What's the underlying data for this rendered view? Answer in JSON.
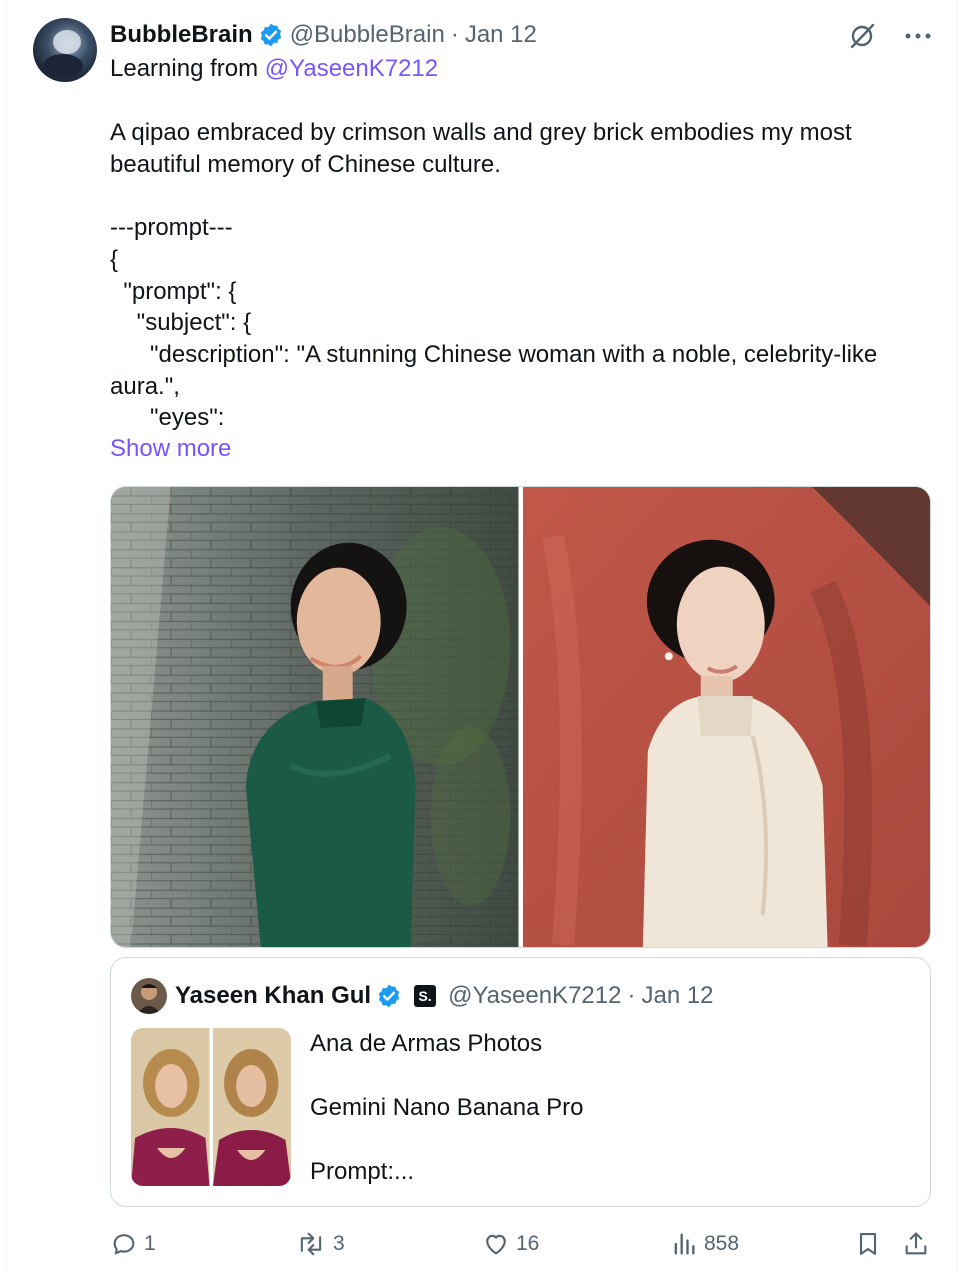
{
  "post": {
    "author_name": "BubbleBrain",
    "handle": "@BubbleBrain",
    "separator": "·",
    "date": "Jan 12",
    "learning_prefix": "Learning from ",
    "learning_mention": "@YaseenK7212",
    "text": "A qipao embraced by crimson walls and grey brick embodies my most beautiful memory of Chinese culture.\n\n---prompt---\n{\n  \"prompt\": {\n    \"subject\": {\n      \"description\": \"A stunning Chinese woman with a noble, celebrity-like aura.\",\n      \"eyes\":",
    "show_more": "Show more"
  },
  "quote": {
    "author_name": "Yaseen Khan Gul",
    "badge": "S.",
    "handle": "@YaseenK7212",
    "separator": "·",
    "date": "Jan 12",
    "text": "Ana de Armas Photos\n\nGemini Nano Banana Pro\n\nPrompt:..."
  },
  "actions": {
    "replies": "1",
    "reposts": "3",
    "likes": "16",
    "views": "858"
  },
  "icons": {
    "verified": "verified-badge-icon",
    "grok": "grok-icon",
    "more": "more-icon",
    "reply": "reply-icon",
    "repost": "repost-icon",
    "like": "heart-icon",
    "views": "views-icon",
    "bookmark": "bookmark-icon",
    "share": "share-icon"
  },
  "colors": {
    "accent": "#7856ff",
    "verified": "#1d9bf0",
    "secondary_text": "#536471",
    "border": "#cfd9de"
  }
}
